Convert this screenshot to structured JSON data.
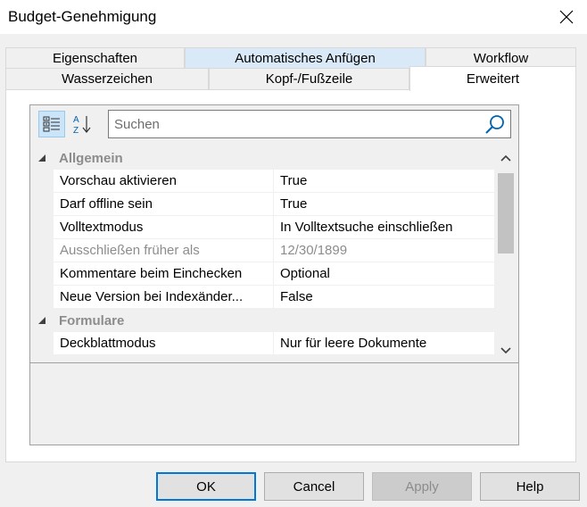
{
  "window": {
    "title": "Budget-Genehmigung"
  },
  "tabs": {
    "row1": [
      "Eigenschaften",
      "Automatisches Anfügen",
      "Workflow"
    ],
    "row2": [
      "Wasserzeichen",
      "Kopf-/Fußzeile",
      "Erweitert"
    ],
    "active": "Erweitert",
    "highlighted": "Automatisches Anfügen"
  },
  "search": {
    "placeholder": "Suchen",
    "value": ""
  },
  "toolbar": {
    "categorized_icon": "categorized-view-icon",
    "alphabetical_icon": "sort-az-icon",
    "search_icon": "magnifier-icon"
  },
  "grid": {
    "categories": [
      {
        "label": "Allgemein",
        "rows": [
          {
            "name": "Vorschau aktivieren",
            "value": "True",
            "enabled": true
          },
          {
            "name": "Darf offline sein",
            "value": "True",
            "enabled": true
          },
          {
            "name": "Volltextmodus",
            "value": "In Volltextsuche einschließen",
            "enabled": true
          },
          {
            "name": "Ausschließen früher als",
            "value": "12/30/1899",
            "enabled": false
          },
          {
            "name": "Kommentare beim Einchecken",
            "value": "Optional",
            "enabled": true
          },
          {
            "name": "Neue Version bei Indexänder...",
            "value": "False",
            "enabled": true
          }
        ]
      },
      {
        "label": "Formulare",
        "rows": [
          {
            "name": "Deckblattmodus",
            "value": "Nur für leere Dokumente",
            "enabled": true
          }
        ]
      }
    ]
  },
  "buttons": {
    "ok": "OK",
    "cancel": "Cancel",
    "apply": "Apply",
    "help": "Help"
  },
  "colors": {
    "accent": "#0078d7",
    "tab_highlight": "#d9e9f7",
    "disabled_text": "#8c8c8c"
  }
}
